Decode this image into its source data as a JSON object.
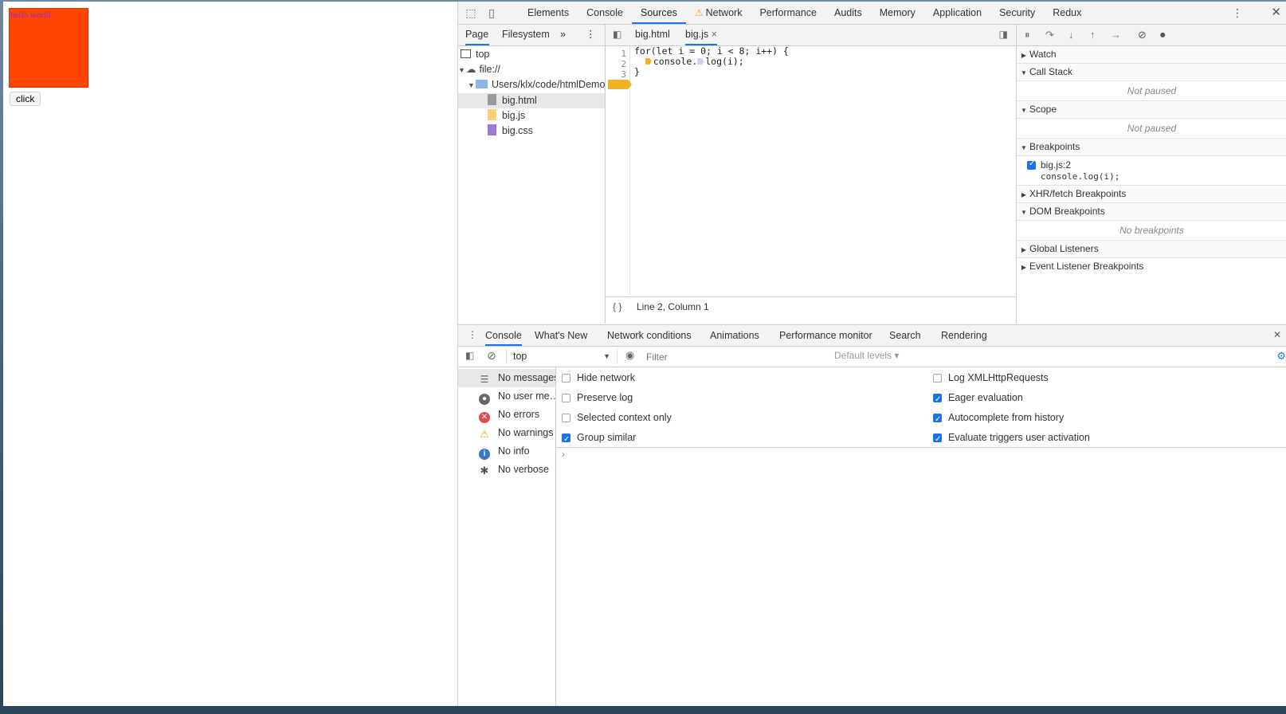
{
  "page": {
    "box_text": "hello world",
    "button_label": "click"
  },
  "devtools": {
    "main_tabs": [
      "Elements",
      "Console",
      "Sources",
      "Network",
      "Performance",
      "Audits",
      "Memory",
      "Application",
      "Security",
      "Redux"
    ],
    "active_main_tab": "Sources",
    "navigator": {
      "tabs": [
        "Page",
        "Filesystem"
      ],
      "more": "»",
      "tree": {
        "top": "top",
        "origin": "file://",
        "folder": "Users/klx/code/htmlDemo",
        "files": [
          "big.html",
          "big.js",
          "big.css"
        ],
        "selected_file": "big.html"
      }
    },
    "editor": {
      "tabs": [
        "big.html",
        "big.js"
      ],
      "active_tab": "big.js",
      "close_glyph": "×",
      "line_numbers": [
        "1",
        "2",
        "3"
      ],
      "lines": {
        "l1": "for(let i = 0; i < 8; i++) {",
        "l2a": "console.",
        "l2b": "log(i);",
        "l3": "}"
      },
      "status": "Line 2, Column 1",
      "format_glyph": "{ }"
    },
    "debugger": {
      "watch": "Watch",
      "call_stack": "Call Stack",
      "call_stack_empty": "Not paused",
      "scope": "Scope",
      "scope_empty": "Not paused",
      "breakpoints": "Breakpoints",
      "breakpoint_file": "big.js:2",
      "breakpoint_code": "console.log(i);",
      "xhr": "XHR/fetch Breakpoints",
      "dom": "DOM Breakpoints",
      "dom_empty": "No breakpoints",
      "global": "Global Listeners",
      "event": "Event Listener Breakpoints"
    },
    "drawer": {
      "tabs": [
        "Console",
        "What's New",
        "Network conditions",
        "Animations",
        "Performance monitor",
        "Search",
        "Rendering"
      ],
      "active_tab": "Console",
      "context": "top",
      "filter_placeholder": "Filter",
      "levels": "Default levels ▾",
      "sidebar": [
        "No messages",
        "No user me…",
        "No errors",
        "No warnings",
        "No info",
        "No verbose"
      ],
      "settings_left": [
        {
          "label": "Hide network",
          "checked": false
        },
        {
          "label": "Preserve log",
          "checked": false
        },
        {
          "label": "Selected context only",
          "checked": false
        },
        {
          "label": "Group similar",
          "checked": true
        }
      ],
      "settings_right": [
        {
          "label": "Log XMLHttpRequests",
          "checked": false
        },
        {
          "label": "Eager evaluation",
          "checked": true
        },
        {
          "label": "Autocomplete from history",
          "checked": true
        },
        {
          "label": "Evaluate triggers user activation",
          "checked": true
        }
      ],
      "prompt": "›"
    }
  },
  "colors": {
    "accent": "#1a73e8",
    "box": "#ff4500",
    "breakpoint": "#f0b323"
  }
}
